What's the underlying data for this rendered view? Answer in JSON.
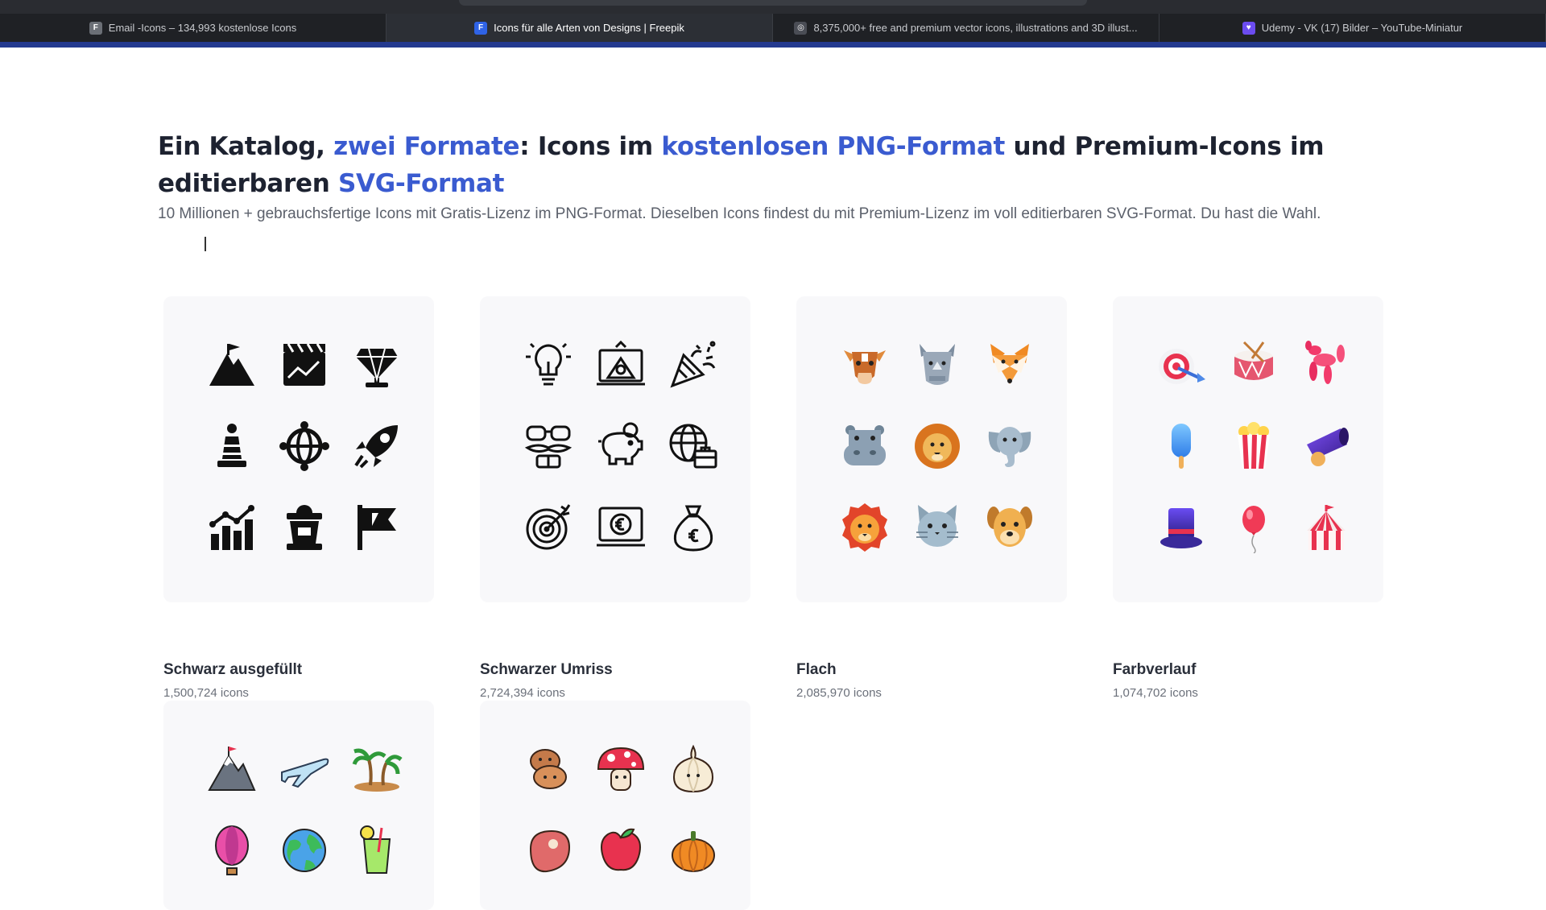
{
  "browser": {
    "tabs": [
      {
        "label": "Email -Icons – 134,993 kostenlose Icons",
        "favicon": "F",
        "favicon_color": "#6b6f76",
        "active": false
      },
      {
        "label": "Icons für alle Arten von Designs | Freepik",
        "favicon": "F",
        "favicon_color": "#2f63e6",
        "active": true
      },
      {
        "label": "8,375,000+ free and premium vector icons, illustrations and 3D illust...",
        "favicon": "◎",
        "favicon_color": "#4a4d55",
        "active": false
      },
      {
        "label": "Udemy - VK (17) Bilder – YouTube-Miniatur",
        "favicon": "♥",
        "favicon_color": "#6b4cf0",
        "active": false
      }
    ]
  },
  "heading": {
    "part1": "Ein Katalog, ",
    "hl1": "zwei Formate",
    "part2": ": Icons im ",
    "hl2": "kostenlosen PNG-Format",
    "part3": " und Premium-Icons im editierbaren ",
    "hl3": "SVG-Format"
  },
  "subtitle": "10 Millionen + gebrauchsfertige Icons mit Gratis-Lizenz im PNG-Format. Dieselben Icons findest du mit Premium-Lizenz im voll editierbaren SVG-Format. Du hast die Wahl.",
  "categories": [
    {
      "title": "Schwarz ausgefüllt",
      "count": "1,500,724 icons"
    },
    {
      "title": "Schwarzer Umriss",
      "count": "2,724,394 icons"
    },
    {
      "title": "Flach",
      "count": "2,085,970 icons"
    },
    {
      "title": "Farbverlauf",
      "count": "1,074,702 icons"
    }
  ],
  "colors": {
    "accent": "#3a5bd0",
    "heading": "#1d2230",
    "tabbar": "#1f2125",
    "brandbar": "#243a8f"
  }
}
